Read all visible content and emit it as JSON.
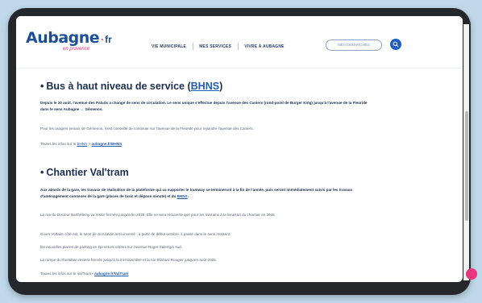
{
  "header": {
    "logo_main": "Aubagne",
    "logo_sep": "·",
    "logo_fr": "fr",
    "logo_sub": "en provence",
    "nav": [
      "VIE MUNICIPALE",
      "MES SERVICES",
      "VIVRE À AUBAGNE"
    ],
    "demarches": "MES DÉMARCHES"
  },
  "sections": [
    {
      "title_prefix": "Bus à haut niveau de service (",
      "title_abbr": "BHNS",
      "title_suffix": ")",
      "intro": "Depuis le 20 août, l'avenue des Paluds a changé de sens de circulation. Le sens unique s'effectue depuis l'avenue des Caniers (rond-point de Burger King) jusqu'à l'avenue de la Fleuride dans le sens Aubagne → Gémenos.",
      "paragraphs": [
        "Pour les usagers venant de Gémenos, il est conseillé de continuer sur l'avenue de la Fleuride pour rejoindre l'avenue des Caniers."
      ],
      "more_prefix": "Toutes les infos sur le ",
      "more_abbr": "BHNS",
      "more_sep": " > ",
      "more_link": "aubagne.fr/BHNS"
    },
    {
      "title_prefix": "Chantier Val'tram",
      "intro": "Aux abords de la gare, les travaux de réalisation de la plateforme qui va supporter le tramway se termineront à la fin de l'année, puis seront immédiatement suivis par les travaux d'aménagement connexes de la gare (places de taxis et dépose minute) et du ",
      "intro_link": "BHNS",
      "intro_end": ".",
      "paragraphs": [
        "La rue du Docteur Barthélemy va rester fermée jusqu'à fin 2025. Elle ne sera réouverte que pour les riverains à la livraison du chantier en 2026.",
        "Cours Voltaire côté est, le sens de circulation sera inversé : à partir de début octobre, il passe dans le sens montant.",
        "De nouvelles places de parking en épi seront créées sur l'avenue Roger Salengro sud.",
        "La rampe du Gerlaban restera fermée jusqu'à la mi-novembre et la rue Elzéard Rougier jusqu'en août 2025."
      ],
      "more_prefix": "Toutes les infos sur le Val'Tram> ",
      "more_link": "aubagne.fr/ValTram"
    }
  ]
}
